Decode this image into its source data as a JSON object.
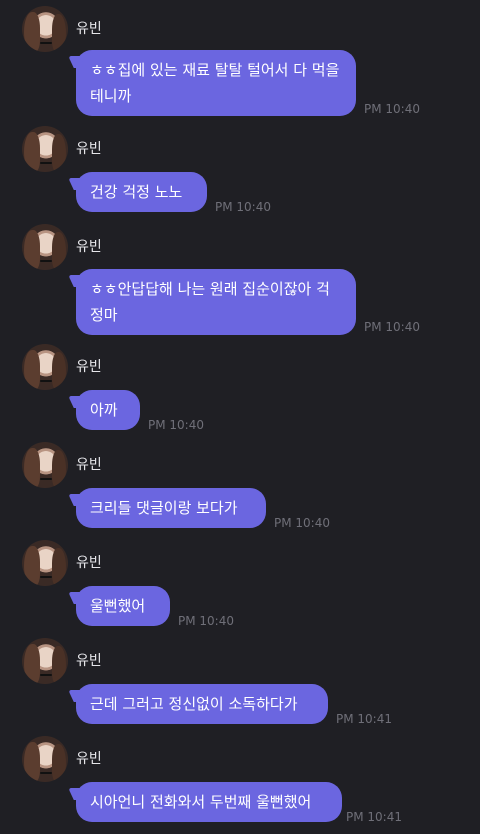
{
  "messages": [
    {
      "sender": "유빈",
      "text": "ㅎㅎ집에 있는 재료 탈탈 털어서 다 먹을테니까",
      "time": "PM 10:40"
    },
    {
      "sender": "유빈",
      "text": "건강 걱정 노노",
      "time": "PM 10:40"
    },
    {
      "sender": "유빈",
      "text": "ㅎㅎ안답답해 나는 원래 집순이잖아 걱정마",
      "time": "PM 10:40"
    },
    {
      "sender": "유빈",
      "text": "아까",
      "time": "PM 10:40"
    },
    {
      "sender": "유빈",
      "text": "크리들 댓글이랑 보다가",
      "time": "PM 10:40"
    },
    {
      "sender": "유빈",
      "text": "울뻔했어",
      "time": "PM 10:40"
    },
    {
      "sender": "유빈",
      "text": "근데 그러고 정신없이 소독하다가",
      "time": "PM 10:41"
    },
    {
      "sender": "유빈",
      "text": "시아언니 전화와서 두번째 울뻔했어",
      "time": "PM 10:41"
    }
  ],
  "colors": {
    "background": "#1f1f24",
    "bubble": "#6b66e0",
    "timestamp": "#6f6f78"
  }
}
